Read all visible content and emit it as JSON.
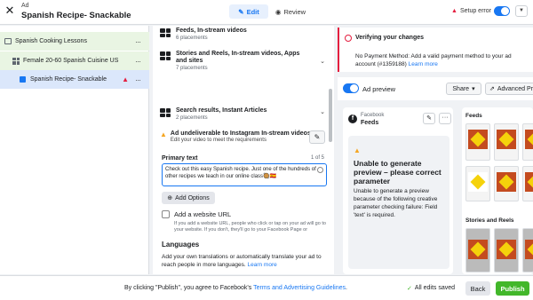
{
  "header": {
    "close_icon": "✕",
    "subtitle": "Ad",
    "title": "Spanish Recipe- Snackable",
    "edit_label": "Edit",
    "review_label": "Review",
    "setup_error": "Setup error",
    "colors": {
      "accent": "#1877f2",
      "error": "#e41e3f",
      "publish": "#42b72a"
    }
  },
  "tree": {
    "campaign": "Spanish Cooking Lessons",
    "adset": "Female 20-60 Spanish Cuisine US",
    "ad": "Spanish Recipe- Snackable",
    "more": "···"
  },
  "editor": {
    "placements": [
      {
        "title": "Feeds, In-stream videos",
        "sub": "6 placements"
      },
      {
        "title": "Stories and Reels, In-stream videos, Apps and sites",
        "sub": "7 placements"
      },
      {
        "title": "Search results, Instant Articles",
        "sub": "2 placements"
      }
    ],
    "undeliverable_title": "Ad undeliverable to Instagram In-stream videos",
    "undeliverable_sub": "Edit your video to meet the requirements",
    "primary_text_label": "Primary text",
    "primary_text_count": "1 of 5",
    "primary_text_value": "Check out this easy Spanish recipe. Just one of the hundreds of other recipes we teach in our online class🥘🇪🇸",
    "add_options": "Add Options",
    "website_label": "Add a website URL",
    "website_help": "If you add a website URL, people who click or tap on your ad will go to your website. If you don't, they'll go to your Facebook Page or Instagram account.",
    "languages_title": "Languages",
    "languages_desc": "Add your own translations or automatically translate your ad to reach people in more languages.",
    "learn_more": "Learn more"
  },
  "preview": {
    "verify_title": "Verifying your changes",
    "verify_body": "No Payment Method: Add a valid payment method to your ad account (#1359188)",
    "learn_more": "Learn more",
    "ad_preview_label": "Ad preview",
    "share_label": "Share",
    "advanced_label": "Advanced Pr",
    "fb_name": "Facebook",
    "fb_feeds": "Feeds",
    "error_title": "Unable to generate preview – please correct parameter",
    "error_body": "Unable to generate a preview because of the following creative parameter checking failure: Field 'text' is required.",
    "feeds_label": "Feeds",
    "stories_label": "Stories and Reels"
  },
  "footer": {
    "consent_prefix": "By clicking \"Publish\", you agree to Facebook's ",
    "consent_link": "Terms and Advertising Guidelines",
    "consent_suffix": ".",
    "saved": "All edits saved",
    "back": "Back",
    "publish": "Publish"
  }
}
